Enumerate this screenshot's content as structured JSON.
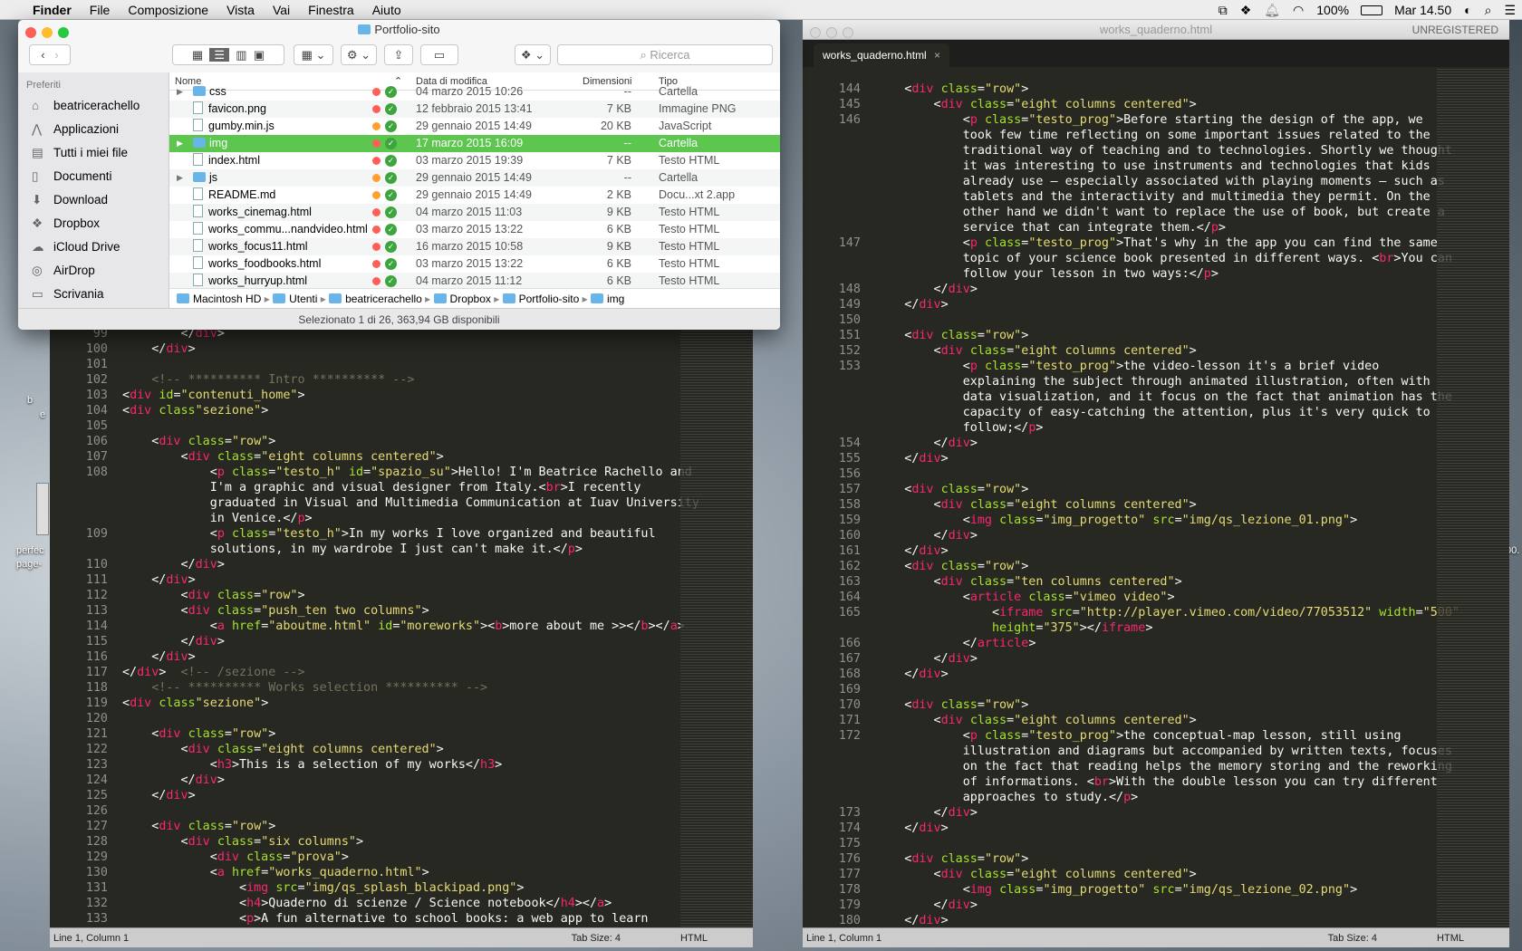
{
  "menubar": {
    "app": "Finder",
    "items": [
      "File",
      "Composizione",
      "Vista",
      "Vai",
      "Finestra",
      "Aiuto"
    ],
    "battery": "100%",
    "clock": "Mar 14.50"
  },
  "desktop": {
    "labels": [
      "b",
      "e",
      "perfec",
      "page-",
      "00."
    ]
  },
  "finder": {
    "title": "Portfolio-sito",
    "search_placeholder": "Ricerca",
    "sidebar_header": "Preferiti",
    "sidebar": [
      "beatricerachello",
      "Applicazioni",
      "Tutti i miei file",
      "Documenti",
      "Download",
      "Dropbox",
      "iCloud Drive",
      "AirDrop",
      "Scrivania"
    ],
    "columns": {
      "name": "Nome",
      "date": "Data di modifica",
      "size": "Dimensioni",
      "type": "Tipo"
    },
    "files": [
      {
        "name": "css",
        "date": "04 marzo 2015 10:26",
        "size": "--",
        "type": "Cartella"
      },
      {
        "name": "favicon.png",
        "date": "12 febbraio 2015 13:41",
        "size": "7 KB",
        "type": "Immagine PNG"
      },
      {
        "name": "gumby.min.js",
        "date": "29 gennaio 2015 14:49",
        "size": "20 KB",
        "type": "JavaScript"
      },
      {
        "name": "img",
        "date": "17 marzo 2015 16:09",
        "size": "--",
        "type": "Cartella"
      },
      {
        "name": "index.html",
        "date": "03 marzo 2015 19:39",
        "size": "7 KB",
        "type": "Testo HTML"
      },
      {
        "name": "js",
        "date": "29 gennaio 2015 14:49",
        "size": "--",
        "type": "Cartella"
      },
      {
        "name": "README.md",
        "date": "29 gennaio 2015 14:49",
        "size": "2 KB",
        "type": "Docu...xt 2.app"
      },
      {
        "name": "works_cinemag.html",
        "date": "04 marzo 2015 11:03",
        "size": "9 KB",
        "type": "Testo HTML"
      },
      {
        "name": "works_commu...nandvideo.html",
        "date": "03 marzo 2015 13:22",
        "size": "6 KB",
        "type": "Testo HTML"
      },
      {
        "name": "works_focus11.html",
        "date": "16 marzo 2015 10:58",
        "size": "9 KB",
        "type": "Testo HTML"
      },
      {
        "name": "works_foodbooks.html",
        "date": "03 marzo 2015 13:22",
        "size": "6 KB",
        "type": "Testo HTML"
      },
      {
        "name": "works_hurryup.html",
        "date": "04 marzo 2015 11:12",
        "size": "6 KB",
        "type": "Testo HTML"
      }
    ],
    "selected_index": 3,
    "folder_indices": [
      0,
      3,
      5
    ],
    "dot_colors": [
      "#ff5f57",
      "#ff5f57",
      "#ffa033",
      "#ff5f57",
      "#ff5f57",
      "#ffa033",
      "#ffa033",
      "#ff5f57",
      "#ff5f57",
      "#ff5f57",
      "#ff5f57",
      "#ff5f57"
    ],
    "path": [
      "Macintosh HD",
      "Utenti",
      "beatricerachello",
      "Dropbox",
      "Portfolio-sito",
      "img"
    ],
    "status": "Selezionato 1 di 26, 363,94 GB disponibili"
  },
  "left_editor": {
    "lines": [
      {
        "n": "99",
        "h": "        &lt;/<span class=t>div</span>&gt;"
      },
      {
        "n": "100",
        "h": "    &lt;/<span class=t>div</span>&gt;"
      },
      {
        "n": "101",
        "h": ""
      },
      {
        "n": "102",
        "h": "    <span class=c>&lt;!-- ********** Intro ********** --&gt;</span>"
      },
      {
        "n": "103",
        "h": "&lt;<span class=t>div</span> <span class=a>id</span>=<span class=s>\"contenuti_home\"</span>&gt;"
      },
      {
        "n": "104",
        "h": "&lt;<span class=t>div</span> <span class=a>class</span><span class=s>\"sezione\"</span>&gt;"
      },
      {
        "n": "105",
        "h": ""
      },
      {
        "n": "106",
        "h": "    &lt;<span class=t>div</span> <span class=a>class</span>=<span class=s>\"row\"</span>&gt;"
      },
      {
        "n": "107",
        "h": "        &lt;<span class=t>div</span> <span class=a>class</span>=<span class=s>\"eight columns centered\"</span>&gt;"
      },
      {
        "n": "108",
        "h": "            &lt;<span class=t>p</span> <span class=a>class</span>=<span class=s>\"testo_h\"</span> <span class=a>id</span>=<span class=s>\"spazio_su\"</span>&gt;Hello! I'm Beatrice Rachello and"
      },
      {
        "n": "",
        "h": "            I'm a graphic and visual designer from Italy.&lt;<span class=t>br</span>&gt;I recently"
      },
      {
        "n": "",
        "h": "            graduated in Visual and Multimedia Communication at Iuav University"
      },
      {
        "n": "",
        "h": "            in Venice.&lt;/<span class=t>p</span>&gt;"
      },
      {
        "n": "109",
        "h": "            &lt;<span class=t>p</span> <span class=a>class</span>=<span class=s>\"testo_h\"</span>&gt;In my works I love organized and beautiful"
      },
      {
        "n": "",
        "h": "            solutions, in my wardrobe I just can't make it.&lt;/<span class=t>p</span>&gt;"
      },
      {
        "n": "110",
        "h": "        &lt;/<span class=t>div</span>&gt;"
      },
      {
        "n": "111",
        "h": "    &lt;/<span class=t>div</span>&gt;"
      },
      {
        "n": "112",
        "h": "        &lt;<span class=t>div</span> <span class=a>class</span>=<span class=s>\"row\"</span>&gt;"
      },
      {
        "n": "113",
        "h": "        &lt;<span class=t>div</span> <span class=a>class</span>=<span class=s>\"push_ten two columns\"</span>&gt;"
      },
      {
        "n": "114",
        "h": "            &lt;<span class=t>a</span> <span class=a>href</span>=<span class=s>\"aboutme.html\"</span> <span class=a>id</span>=<span class=s>\"moreworks\"</span>&gt;&lt;<span class=t>b</span>&gt;more about me &gt;&gt;&lt;/<span class=t>b</span>&gt;&lt;/<span class=t>a</span>&gt;"
      },
      {
        "n": "115",
        "h": "        &lt;/<span class=t>div</span>&gt;"
      },
      {
        "n": "116",
        "h": "    &lt;/<span class=t>div</span>&gt;"
      },
      {
        "n": "117",
        "h": "&lt;/<span class=t>div</span>&gt;  <span class=c>&lt;!-- /sezione --&gt;</span>"
      },
      {
        "n": "118",
        "h": "    <span class=c>&lt;!-- ********** Works selection ********** --&gt;</span>"
      },
      {
        "n": "119",
        "h": "&lt;<span class=t>div</span> <span class=a>class</span><span class=s>\"sezione\"</span>&gt;"
      },
      {
        "n": "120",
        "h": ""
      },
      {
        "n": "121",
        "h": "    &lt;<span class=t>div</span> <span class=a>class</span>=<span class=s>\"row\"</span>&gt;"
      },
      {
        "n": "122",
        "h": "        &lt;<span class=t>div</span> <span class=a>class</span>=<span class=s>\"eight columns centered\"</span>&gt;"
      },
      {
        "n": "123",
        "h": "            &lt;<span class=t>h3</span>&gt;This is a selection of my works&lt;/<span class=t>h3</span>&gt;"
      },
      {
        "n": "124",
        "h": "        &lt;/<span class=t>div</span>&gt;"
      },
      {
        "n": "125",
        "h": "    &lt;/<span class=t>div</span>&gt;"
      },
      {
        "n": "126",
        "h": ""
      },
      {
        "n": "127",
        "h": "    &lt;<span class=t>div</span> <span class=a>class</span>=<span class=s>\"row\"</span>&gt;"
      },
      {
        "n": "128",
        "h": "        &lt;<span class=t>div</span> <span class=a>class</span>=<span class=s>\"six columns\"</span>&gt;"
      },
      {
        "n": "129",
        "h": "            &lt;<span class=t>div</span> <span class=a>class</span>=<span class=s>\"prova\"</span>&gt;"
      },
      {
        "n": "130",
        "h": "            &lt;<span class=t>a</span> <span class=a>href</span>=<span class=s>\"works_quaderno.html\"</span>&gt;"
      },
      {
        "n": "131",
        "h": "                &lt;<span class=t>img</span> <span class=a>src</span>=<span class=s>\"img/qs_splash_blackipad.png\"</span>&gt;"
      },
      {
        "n": "132",
        "h": "                &lt;<span class=t>h4</span>&gt;Quaderno di scienze / Science notebook&lt;/<span class=t>h4</span>&gt;&lt;/<span class=t>a</span>&gt;"
      },
      {
        "n": "133",
        "h": "                &lt;<span class=t>p</span>&gt;A fun alternative to school books: a web app to learn"
      }
    ],
    "status": {
      "pos": "Line 1, Column 1",
      "tab": "Tab Size: 4",
      "syntax": "HTML"
    }
  },
  "right_editor": {
    "title": "works_quaderno.html",
    "unregistered": "UNREGISTERED",
    "tab": "works_quaderno.html",
    "lines": [
      {
        "n": "144",
        "h": "    &lt;<span class=t>div</span> <span class=a>class</span>=<span class=s>\"row\"</span>&gt;"
      },
      {
        "n": "145",
        "h": "        &lt;<span class=t>div</span> <span class=a>class</span>=<span class=s>\"eight columns centered\"</span>&gt;"
      },
      {
        "n": "146",
        "h": "            &lt;<span class=t>p</span> <span class=a>class</span>=<span class=s>\"testo_prog\"</span>&gt;Before starting the design of the app, we"
      },
      {
        "n": "",
        "h": "            took few time reflecting on some important issues related to the"
      },
      {
        "n": "",
        "h": "            traditional way of teaching and to technologies. Shortly we thought"
      },
      {
        "n": "",
        "h": "            it was interesting to use instruments and technologies that kids"
      },
      {
        "n": "",
        "h": "            already use – especially associated with playing moments – such as"
      },
      {
        "n": "",
        "h": "            tablets and the interactivity and multimedia they permit. On the"
      },
      {
        "n": "",
        "h": "            other hand we didn't want to replace the use of book, but create a"
      },
      {
        "n": "",
        "h": "            service that can integrate them.&lt;/<span class=t>p</span>&gt;"
      },
      {
        "n": "147",
        "h": "            &lt;<span class=t>p</span> <span class=a>class</span>=<span class=s>\"testo_prog\"</span>&gt;That's why in the app you can find the same"
      },
      {
        "n": "",
        "h": "            topic of your science book presented in different ways. &lt;<span class=t>br</span>&gt;You can"
      },
      {
        "n": "",
        "h": "            follow your lesson in two ways:&lt;/<span class=t>p</span>&gt;"
      },
      {
        "n": "148",
        "h": "        &lt;/<span class=t>div</span>&gt;"
      },
      {
        "n": "149",
        "h": "    &lt;/<span class=t>div</span>&gt;"
      },
      {
        "n": "150",
        "h": ""
      },
      {
        "n": "151",
        "h": "    &lt;<span class=t>div</span> <span class=a>class</span>=<span class=s>\"row\"</span>&gt;"
      },
      {
        "n": "152",
        "h": "        &lt;<span class=t>div</span> <span class=a>class</span>=<span class=s>\"eight columns centered\"</span>&gt;"
      },
      {
        "n": "153",
        "h": "            &lt;<span class=t>p</span> <span class=a>class</span>=<span class=s>\"testo_prog\"</span>&gt;the video-lesson it's a brief video"
      },
      {
        "n": "",
        "h": "            explaining the subject through animated illustration, often with"
      },
      {
        "n": "",
        "h": "            data visualization, and it focus on the fact that animation has the"
      },
      {
        "n": "",
        "h": "            capacity of easy-catching the attention, plus it's very quick to"
      },
      {
        "n": "",
        "h": "            follow;&lt;/<span class=t>p</span>&gt;"
      },
      {
        "n": "154",
        "h": "        &lt;/<span class=t>div</span>&gt;"
      },
      {
        "n": "155",
        "h": "    &lt;/<span class=t>div</span>&gt;"
      },
      {
        "n": "156",
        "h": ""
      },
      {
        "n": "157",
        "h": "    &lt;<span class=t>div</span> <span class=a>class</span>=<span class=s>\"row\"</span>&gt;"
      },
      {
        "n": "158",
        "h": "        &lt;<span class=t>div</span> <span class=a>class</span>=<span class=s>\"eight columns centered\"</span>&gt;"
      },
      {
        "n": "159",
        "h": "            &lt;<span class=t>img</span> <span class=a>class</span>=<span class=s>\"img_progetto\"</span> <span class=a>src</span>=<span class=s>\"img/qs_lezione_01.png\"</span>&gt;"
      },
      {
        "n": "160",
        "h": "        &lt;/<span class=t>div</span>&gt;"
      },
      {
        "n": "161",
        "h": "    &lt;/<span class=t>div</span>&gt;"
      },
      {
        "n": "162",
        "h": "    &lt;<span class=t>div</span> <span class=a>class</span>=<span class=s>\"row\"</span>&gt;"
      },
      {
        "n": "163",
        "h": "        &lt;<span class=t>div</span> <span class=a>class</span>=<span class=s>\"ten columns centered\"</span>&gt;"
      },
      {
        "n": "164",
        "h": "            &lt;<span class=t>article</span> <span class=a>class</span>=<span class=s>\"vimeo video\"</span>&gt;"
      },
      {
        "n": "165",
        "h": "                &lt;<span class=t>iframe</span> <span class=a>src</span>=<span class=s>\"http://player.vimeo.com/video/77053512\"</span> <span class=a>width</span>=<span class=s>\"500\"</span>"
      },
      {
        "n": "",
        "h": "                <span class=a>height</span>=<span class=s>\"375\"</span>&gt;&lt;/<span class=t>iframe</span>&gt;"
      },
      {
        "n": "166",
        "h": "            &lt;/<span class=t>article</span>&gt;"
      },
      {
        "n": "167",
        "h": "        &lt;/<span class=t>div</span>&gt;"
      },
      {
        "n": "168",
        "h": "    &lt;/<span class=t>div</span>&gt;"
      },
      {
        "n": "169",
        "h": ""
      },
      {
        "n": "170",
        "h": "    &lt;<span class=t>div</span> <span class=a>class</span>=<span class=s>\"row\"</span>&gt;"
      },
      {
        "n": "171",
        "h": "        &lt;<span class=t>div</span> <span class=a>class</span>=<span class=s>\"eight columns centered\"</span>&gt;"
      },
      {
        "n": "172",
        "h": "            &lt;<span class=t>p</span> <span class=a>class</span>=<span class=s>\"testo_prog\"</span>&gt;the conceptual-map lesson, still using"
      },
      {
        "n": "",
        "h": "            illustration and diagrams but accompanied by written texts, focuses"
      },
      {
        "n": "",
        "h": "            on the fact that reading helps the memory storing and the reworking"
      },
      {
        "n": "",
        "h": "            of informations. &lt;<span class=t>br</span>&gt;With the double lesson you can try different"
      },
      {
        "n": "",
        "h": "            approaches to study.&lt;/<span class=t>p</span>&gt;"
      },
      {
        "n": "173",
        "h": "        &lt;/<span class=t>div</span>&gt;"
      },
      {
        "n": "174",
        "h": "    &lt;/<span class=t>div</span>&gt;"
      },
      {
        "n": "175",
        "h": ""
      },
      {
        "n": "176",
        "h": "    &lt;<span class=t>div</span> <span class=a>class</span>=<span class=s>\"row\"</span>&gt;"
      },
      {
        "n": "177",
        "h": "        &lt;<span class=t>div</span> <span class=a>class</span>=<span class=s>\"eight columns centered\"</span>&gt;"
      },
      {
        "n": "178",
        "h": "            &lt;<span class=t>img</span> <span class=a>class</span>=<span class=s>\"img_progetto\"</span> <span class=a>src</span>=<span class=s>\"img/qs_lezione_02.png\"</span>&gt;"
      },
      {
        "n": "179",
        "h": "        &lt;/<span class=t>div</span>&gt;"
      },
      {
        "n": "180",
        "h": "    &lt;/<span class=t>div</span>&gt;"
      }
    ],
    "status": {
      "pos": "Line 1, Column 1",
      "tab": "Tab Size: 4",
      "syntax": "HTML"
    }
  }
}
